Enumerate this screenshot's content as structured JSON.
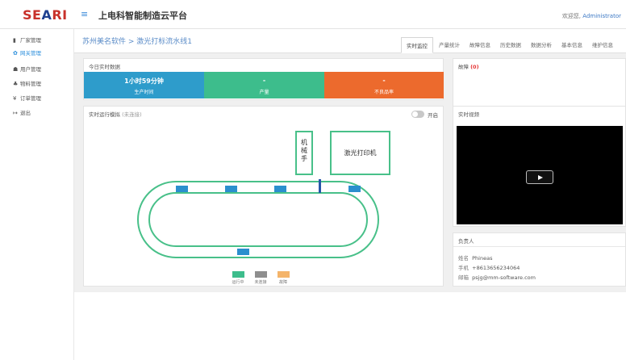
{
  "brand": {
    "logo_pre": "SE",
    "logo_accent": "A",
    "logo_post": "RI"
  },
  "header": {
    "menu_icon": "menu-icon",
    "title": "上电科智能制造云平台",
    "welcome_prefix": "欢迎您,",
    "username": "Administrator"
  },
  "sidebar": {
    "items": [
      {
        "icon": "▮▮",
        "icon_name": "factory-icon",
        "label": "厂家管理"
      },
      {
        "icon": "⚙",
        "icon_name": "gear-icon",
        "label": "网关管理"
      },
      {
        "icon": "👥",
        "icon_name": "users-icon",
        "label": "用户管理"
      },
      {
        "icon": "⚇",
        "icon_name": "material-icon",
        "label": "物料管理"
      },
      {
        "icon": "¥",
        "icon_name": "yen-icon",
        "label": "订单管理"
      },
      {
        "icon": "↦",
        "icon_name": "logout-icon",
        "label": "退出"
      }
    ]
  },
  "breadcrumb": "苏州美名软件 > 激光打标流水线1",
  "tabs": [
    "实时监控",
    "产量统计",
    "故障信息",
    "历史数据",
    "数据分析",
    "基本信息",
    "维护信息"
  ],
  "today": {
    "title": "今日实时数据",
    "stats": [
      {
        "value": "1小时59分钟",
        "label": "生产时间",
        "color": "#2e9ccb"
      },
      {
        "value": "-",
        "label": "产量",
        "color": "#3dbd8c"
      },
      {
        "value": "-",
        "label": "不良品率",
        "color": "#ec6a2d"
      }
    ]
  },
  "fault": {
    "title": "故障",
    "count": "(0)"
  },
  "simulation": {
    "title": "实时运行模拟",
    "subtitle": "(未连接)",
    "toggle_label": "开启",
    "robot_arm": [
      "机",
      "械",
      "手"
    ],
    "printer": "激光打印机",
    "legend": [
      {
        "label": "运行中",
        "color": "#3dbd8c"
      },
      {
        "label": "未连接",
        "color": "#8e8e8e"
      },
      {
        "label": "故障",
        "color": "#f4b46a"
      }
    ]
  },
  "video": {
    "title": "实时视频",
    "play_icon": "play-icon"
  },
  "contact": {
    "title": "负责人",
    "name_label": "姓名",
    "name": "Phineas",
    "phone_label": "手机",
    "phone": "+8613656234064",
    "email_label": "邮箱",
    "email": "psjg@mm-software.com"
  },
  "colors": {
    "accent": "#2d8fdc",
    "track": "#48c089",
    "slot": "#2b8fce",
    "brand_red": "#c8312b"
  }
}
